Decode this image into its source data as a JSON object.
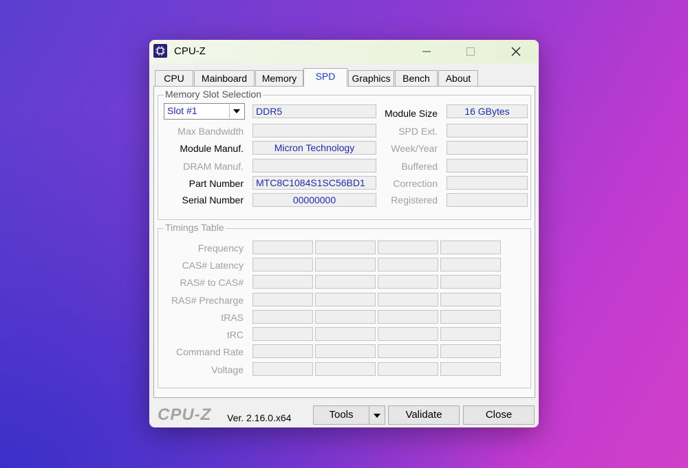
{
  "window": {
    "title": "CPU-Z"
  },
  "tabs": [
    "CPU",
    "Mainboard",
    "Memory",
    "SPD",
    "Graphics",
    "Bench",
    "About"
  ],
  "memory_slot": {
    "group_label": "Memory Slot Selection",
    "slot_value": "Slot #1",
    "type": "DDR5",
    "module_size_label": "Module Size",
    "module_size": "16 GBytes",
    "left_labels": [
      "Max Bandwidth",
      "Module Manuf.",
      "DRAM Manuf.",
      "Part Number",
      "Serial Number"
    ],
    "max_bandwidth": "",
    "module_manuf": "Micron Technology",
    "dram_manuf": "",
    "part_number": "MTC8C1084S1SC56BD1",
    "serial_number": "00000000",
    "right_labels": [
      "SPD Ext.",
      "Week/Year",
      "Buffered",
      "Correction",
      "Registered"
    ]
  },
  "timings": {
    "group_label": "Timings Table",
    "rows": [
      "Frequency",
      "CAS# Latency",
      "RAS# to CAS#",
      "RAS# Precharge",
      "tRAS",
      "tRC",
      "Command Rate",
      "Voltage"
    ]
  },
  "footer": {
    "logo": "CPU-Z",
    "version": "Ver. 2.16.0.x64",
    "tools_label": "Tools",
    "validate_label": "Validate",
    "close_label": "Close"
  },
  "icons": [
    "app-chip-icon",
    "minimize-icon",
    "maximize-icon",
    "close-icon",
    "dropdown-arrow-icon"
  ]
}
